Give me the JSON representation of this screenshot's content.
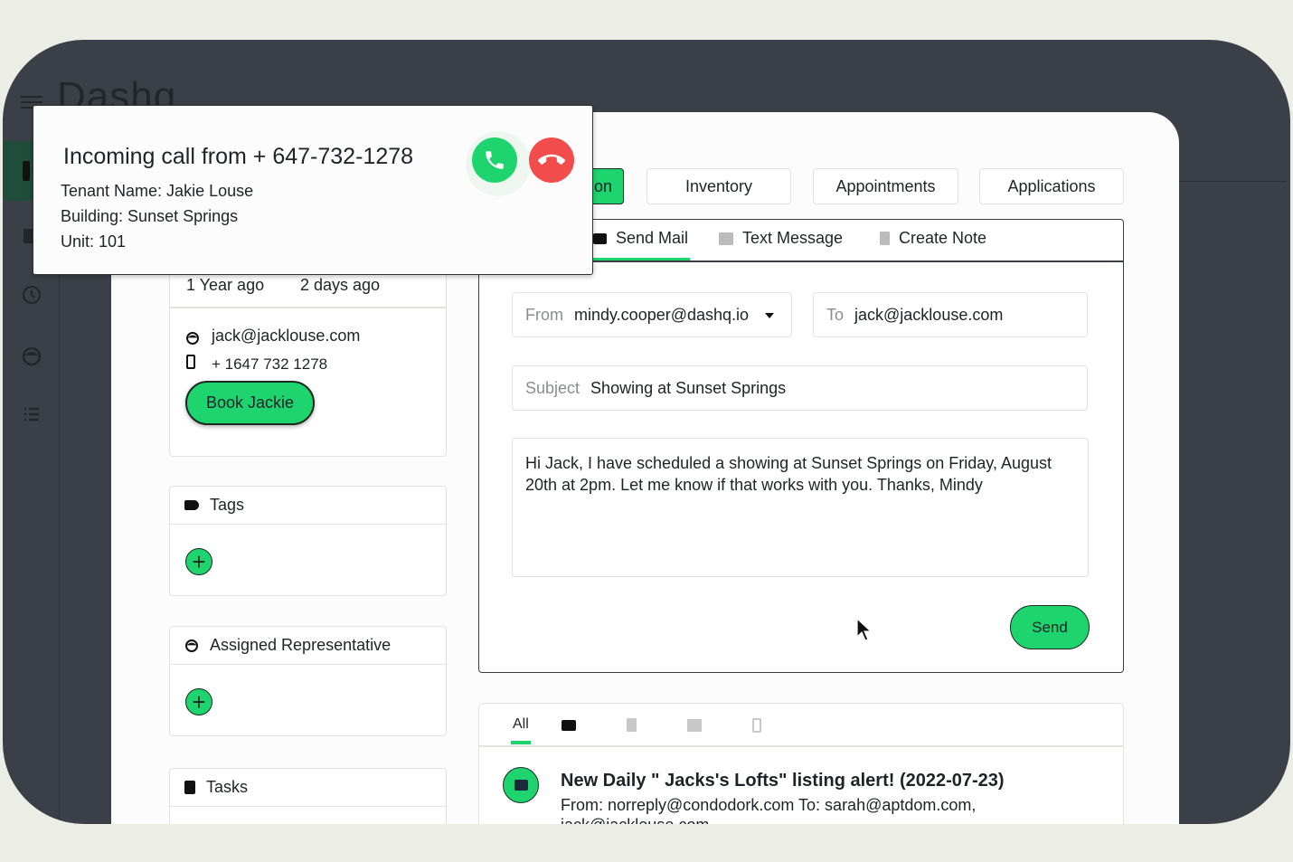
{
  "app": {
    "logo": "Dashq"
  },
  "colors": {
    "accent": "#1ed46e",
    "decline": "#f24c4c",
    "frame": "#3b3f47",
    "background": "#eceee6"
  },
  "sidebar": {
    "icons": [
      "tenant-icon",
      "calendar-icon",
      "clock-icon",
      "face-icon",
      "list-icon"
    ]
  },
  "call": {
    "title": "Incoming call from + 647-732-1278",
    "tenant": "Tenant Name: Jakie Louse",
    "building": "Building: Sunset Springs",
    "unit": "Unit: 101"
  },
  "contact": {
    "since": "1 Year ago",
    "last": "2 days ago",
    "email": "jack@jacklouse.com",
    "phone": "+ 1647 732 1278",
    "book": "Book Jackie"
  },
  "cards": {
    "tags": "Tags",
    "rep": "Assigned Representative",
    "tasks": "Tasks"
  },
  "nav": {
    "tabs": [
      "on",
      "Inventory",
      "Appointments",
      "Applications"
    ]
  },
  "compose": {
    "tabs": [
      "Send Mail",
      "Text Message",
      "Create Note"
    ],
    "from_label": "From",
    "from": "mindy.cooper@dashq.io",
    "to_label": "To",
    "to": "jack@jacklouse.com",
    "subject_label": "Subject",
    "subject": "Showing at Sunset Springs",
    "body": "Hi Jack,  I have scheduled a showing at Sunset Springs on Friday, August 20th at 2pm. Let me know if that works with you.  Thanks,   Mindy",
    "send": "Send"
  },
  "history": {
    "filter_all": "All",
    "item": {
      "title": "New Daily \" Jacks's Lofts\" listing alert! (2022-07-23)",
      "meta": "From: norreply@condodork.com To: sarah@aptdom.com,",
      "meta2": "jack@jacklouse.com"
    }
  }
}
